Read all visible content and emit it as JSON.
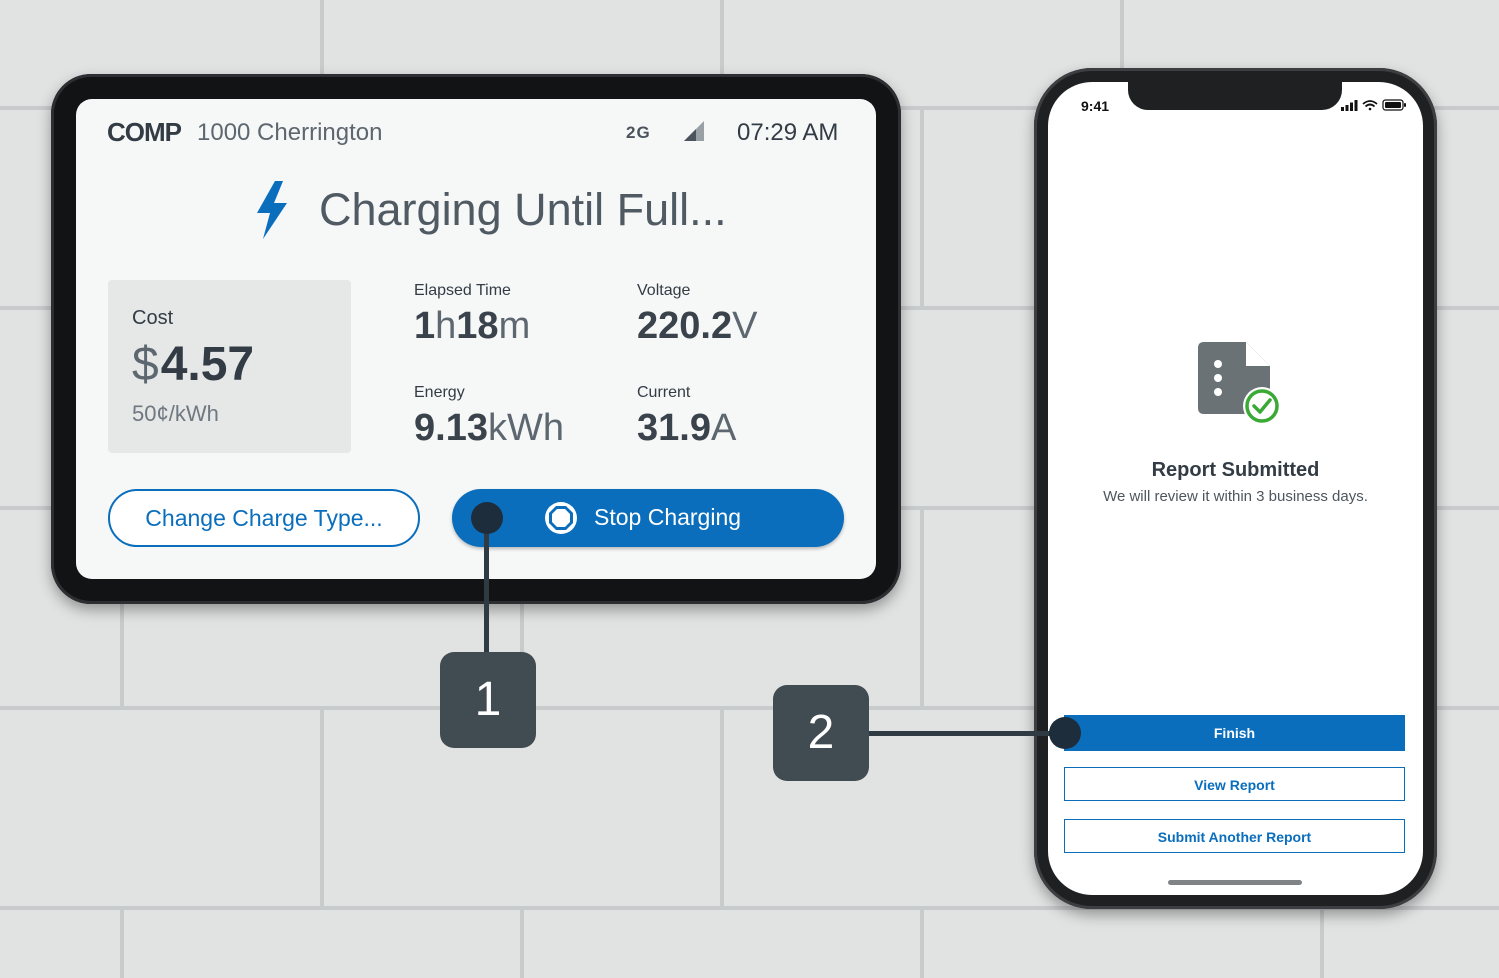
{
  "charger": {
    "brand": "COMP",
    "location": "1000 Cherrington",
    "network": "2G",
    "time": "07:29 AM",
    "status": "Charging Until Full...",
    "cost": {
      "label": "Cost",
      "currency": "$",
      "value": "4.57",
      "rate": "50¢/kWh"
    },
    "metrics": {
      "elapsed": {
        "label": "Elapsed Time",
        "h": "1",
        "h_unit": "h",
        "m": "18",
        "m_unit": "m"
      },
      "voltage": {
        "label": "Voltage",
        "value": "220.2",
        "unit": "V"
      },
      "energy": {
        "label": "Energy",
        "value": "9.13",
        "unit": "kWh"
      },
      "current": {
        "label": "Current",
        "value": "31.9",
        "unit": "A"
      }
    },
    "buttons": {
      "change": "Change Charge Type...",
      "stop": "Stop Charging"
    }
  },
  "callouts": {
    "one": "1",
    "two": "2"
  },
  "phone": {
    "time": "9:41",
    "title": "Report Submitted",
    "subtitle": "We will review it within 3 business days.",
    "buttons": {
      "finish": "Finish",
      "view": "View Report",
      "submit_another": "Submit Another Report"
    }
  },
  "colors": {
    "accent": "#0a6ebd",
    "success": "#3aa935",
    "badge": "#414b52",
    "background": "#e1e3e3"
  }
}
